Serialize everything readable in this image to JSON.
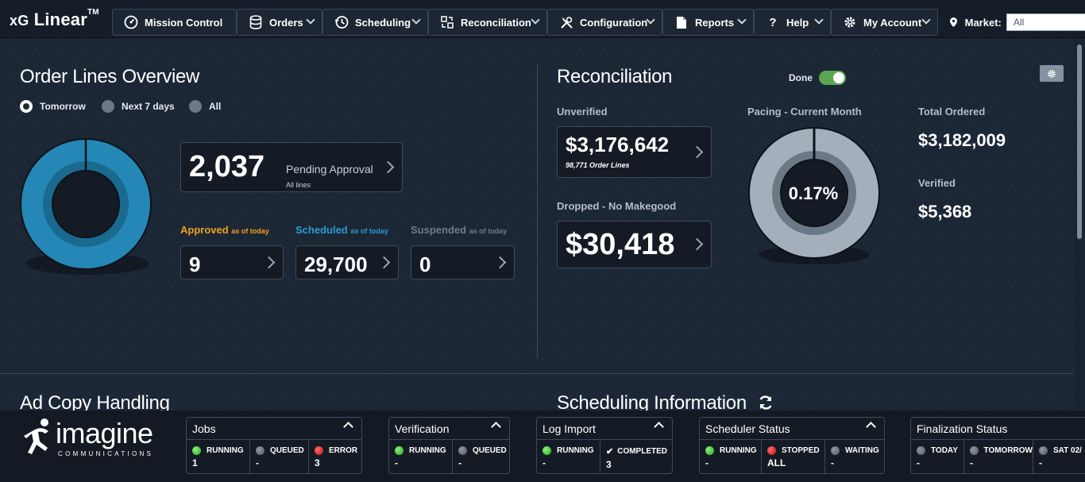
{
  "app": {
    "brand_prefix": "xG",
    "brand_name": "Linear",
    "brand_tm": "TM"
  },
  "nav": {
    "items": [
      {
        "label": "Mission Control",
        "icon": "dashboard-icon"
      },
      {
        "label": "Orders",
        "icon": "database-icon"
      },
      {
        "label": "Scheduling",
        "icon": "clock-history-icon"
      },
      {
        "label": "Reconciliation",
        "icon": "reconcile-icon"
      },
      {
        "label": "Configuration",
        "icon": "tools-icon"
      },
      {
        "label": "Reports",
        "icon": "document-icon"
      },
      {
        "label": "Help",
        "icon": "question-icon"
      },
      {
        "label": "My Account",
        "icon": "gear-icon"
      }
    ],
    "market_label": "Market:",
    "market_value": "All"
  },
  "order_lines": {
    "title": "Order Lines Overview",
    "filters": [
      "Tomorrow",
      "Next 7 days",
      "All"
    ],
    "selected_filter": "Tomorrow",
    "pending": {
      "value": "2,037",
      "label": "Pending Approval",
      "sub": "All lines"
    },
    "approved": {
      "label": "Approved",
      "suffix": "as of today",
      "value": "9",
      "color": "#f0a020"
    },
    "scheduled": {
      "label": "Scheduled",
      "suffix": "as of today",
      "value": "29,700",
      "color": "#2c9ad0"
    },
    "suspended": {
      "label": "Suspended",
      "suffix": "as of today",
      "value": "0",
      "color": "#6f7a87"
    },
    "donut_color": "#2487b5"
  },
  "reconciliation": {
    "title": "Reconciliation",
    "done_label": "Done",
    "done_on": true,
    "unverified": {
      "label": "Unverified",
      "value": "$3,176,642",
      "sub": "98,771 Order Lines"
    },
    "dropped": {
      "label": "Dropped - No Makegood",
      "value": "$30,418"
    },
    "pacing": {
      "label": "Pacing - Current Month",
      "value": "0.17%",
      "fraction": 0.0017
    },
    "total_ordered": {
      "label": "Total Ordered",
      "value": "$3,182,009"
    },
    "verified": {
      "label": "Verified",
      "value": "$5,368"
    }
  },
  "lower": {
    "ad_copy_title": "Ad Copy Handling",
    "scheduling_title": "Scheduling Information"
  },
  "footer": {
    "logo_word": "imagine",
    "logo_sub": "COMMUNICATIONS",
    "panels": [
      {
        "title": "Jobs",
        "cells": [
          {
            "led": "green",
            "status": "RUNNING",
            "value": "1"
          },
          {
            "led": "grey",
            "status": "QUEUED",
            "value": "-"
          },
          {
            "led": "red",
            "status": "ERROR",
            "value": "3"
          }
        ]
      },
      {
        "title": "Verification",
        "cells": [
          {
            "led": "green",
            "status": "RUNNING",
            "value": "-"
          },
          {
            "led": "grey",
            "status": "QUEUED",
            "value": "-"
          }
        ]
      },
      {
        "title": "Log Import",
        "cells": [
          {
            "led": "green",
            "status": "RUNNING",
            "value": "-"
          },
          {
            "led": "check",
            "status": "COMPLETED",
            "value": "3"
          }
        ]
      },
      {
        "title": "Scheduler Status",
        "cells": [
          {
            "led": "green",
            "status": "RUNNING",
            "value": "-"
          },
          {
            "led": "red",
            "status": "STOPPED",
            "value": "ALL"
          },
          {
            "led": "grey",
            "status": "WAITING",
            "value": "-"
          }
        ]
      },
      {
        "title": "Finalization Status",
        "cells": [
          {
            "led": "grey",
            "status": "TODAY",
            "value": "-"
          },
          {
            "led": "grey",
            "status": "TOMORROW",
            "value": "-"
          },
          {
            "led": "grey",
            "status": "SAT 02/",
            "value": "-"
          }
        ]
      }
    ]
  }
}
